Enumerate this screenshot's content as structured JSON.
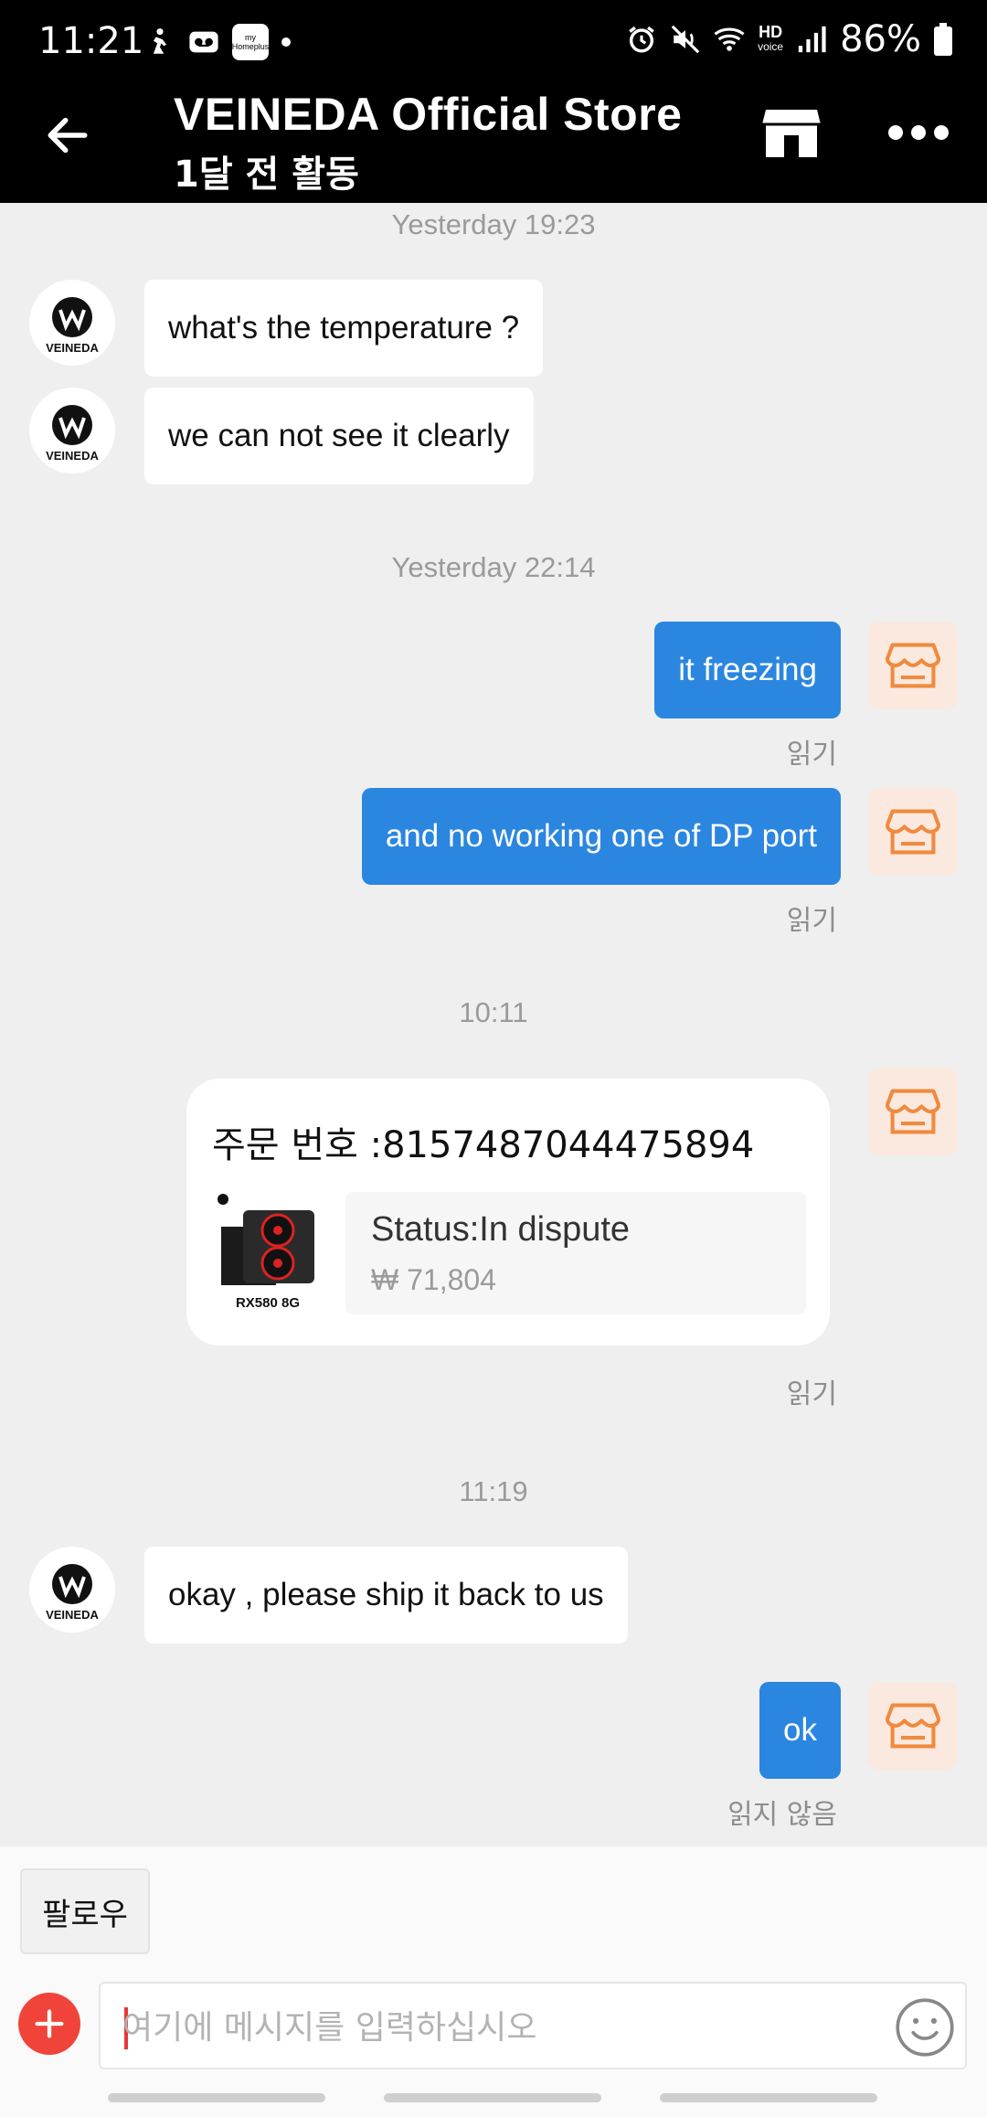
{
  "status_bar": {
    "time": "11:21",
    "myhomeplus_label": "my Homeplus",
    "hd_label": "HD",
    "hd_sub": "voice",
    "battery": "86%"
  },
  "header": {
    "title": "VEINEDA Official Store",
    "subtitle": "1달 전 활동"
  },
  "chat": {
    "ts1": "Yesterday 19:23",
    "m1": "what's the temperature ?",
    "m2": "we can not see it clearly",
    "ts2": "Yesterday 22:14",
    "m3": "it freezing",
    "read1": "읽기",
    "m4": "and no working one of DP port",
    "read2": "읽기",
    "ts3": "10:11",
    "order": {
      "order_no": "주문 번호 :8157487044475894",
      "product_caption": "RX580 8G",
      "status": "Status:In dispute",
      "price": "₩ 71,804"
    },
    "read3": "읽기",
    "ts4": "11:19",
    "m5": "okay , please ship it back to us",
    "m6": "ok",
    "unread": "읽지 않음"
  },
  "store_logo_text": "VEINEDA",
  "bottom": {
    "follow_label": "팔로우",
    "input_placeholder": "여기에 메시지를 입력하십시오"
  },
  "colors": {
    "accent_blue": "#2b86e0",
    "plus_red": "#f0443a",
    "shop_orange": "#f08a3e"
  }
}
